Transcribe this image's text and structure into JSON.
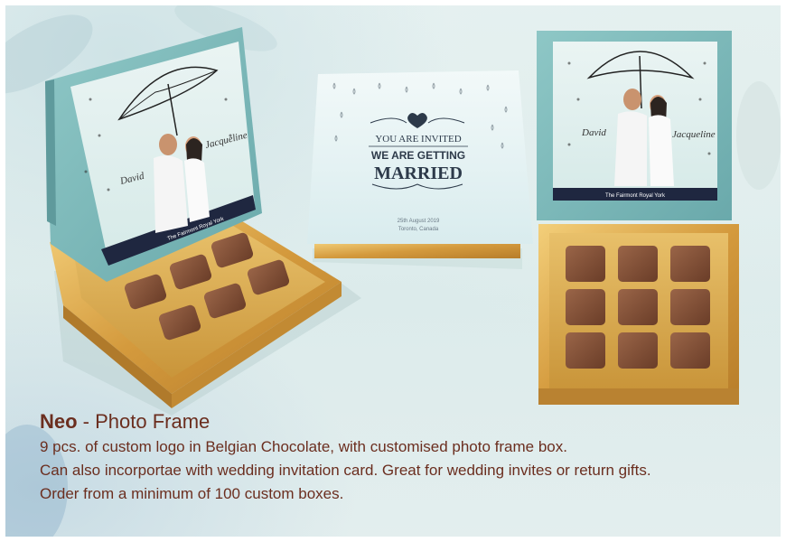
{
  "product": {
    "name": "Neo",
    "separator": " - ",
    "subtitle": "Photo Frame",
    "description_lines": [
      "9 pcs. of custom logo in  Belgian Chocolate, with customised photo frame box.",
      "Can also incorportae with wedding invitation card. Great for wedding invites or return gifts.",
      "Order from a minimum of 100 custom boxes."
    ]
  },
  "photo_frame": {
    "name_left": "David",
    "name_right": "Jacqueline",
    "venue": "The Fairmont Royal York"
  },
  "invitation_card": {
    "line1": "YOU ARE INVITED",
    "line2": "WE ARE GETTING",
    "line3": "MARRIED",
    "date": "25th August 2019",
    "place": "Toronto, Canada"
  },
  "colors": {
    "teal": "#7fb8b9",
    "gold": "#d9a94b",
    "chocolate": "#7a4a32",
    "caption_text": "#6b2e1f"
  }
}
